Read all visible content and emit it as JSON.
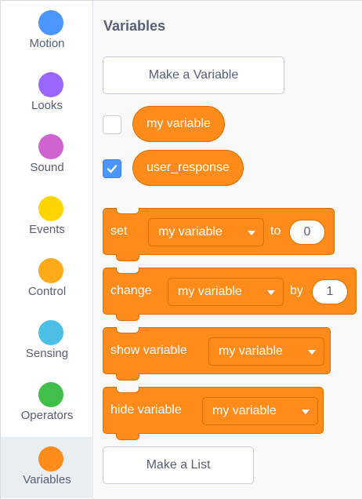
{
  "categories": [
    {
      "label": "Motion",
      "color": "#4c97ff"
    },
    {
      "label": "Looks",
      "color": "#9966ff"
    },
    {
      "label": "Sound",
      "color": "#cf63cf"
    },
    {
      "label": "Events",
      "color": "#ffd500"
    },
    {
      "label": "Control",
      "color": "#ffab19"
    },
    {
      "label": "Sensing",
      "color": "#4cbfe6"
    },
    {
      "label": "Operators",
      "color": "#40bf4a"
    },
    {
      "label": "Variables",
      "color": "#ff8c1a"
    }
  ],
  "active_category": "Variables",
  "palette": {
    "title": "Variables",
    "make_variable_label": "Make a Variable",
    "make_list_label": "Make a List",
    "variables": [
      {
        "name": "my variable",
        "checked": false
      },
      {
        "name": "user_response",
        "checked": true
      }
    ],
    "blocks": {
      "set": {
        "label": "set",
        "variable": "my variable",
        "connector": "to",
        "value": "0"
      },
      "change": {
        "label": "change",
        "variable": "my variable",
        "connector": "by",
        "value": "1"
      },
      "show": {
        "label": "show variable",
        "variable": "my variable"
      },
      "hide": {
        "label": "hide variable",
        "variable": "my variable"
      }
    }
  },
  "colors": {
    "variables_block": "#ff8c1a",
    "checkbox_checked": "#4c97ff",
    "sidebar_active_bg": "#e9eef2"
  }
}
